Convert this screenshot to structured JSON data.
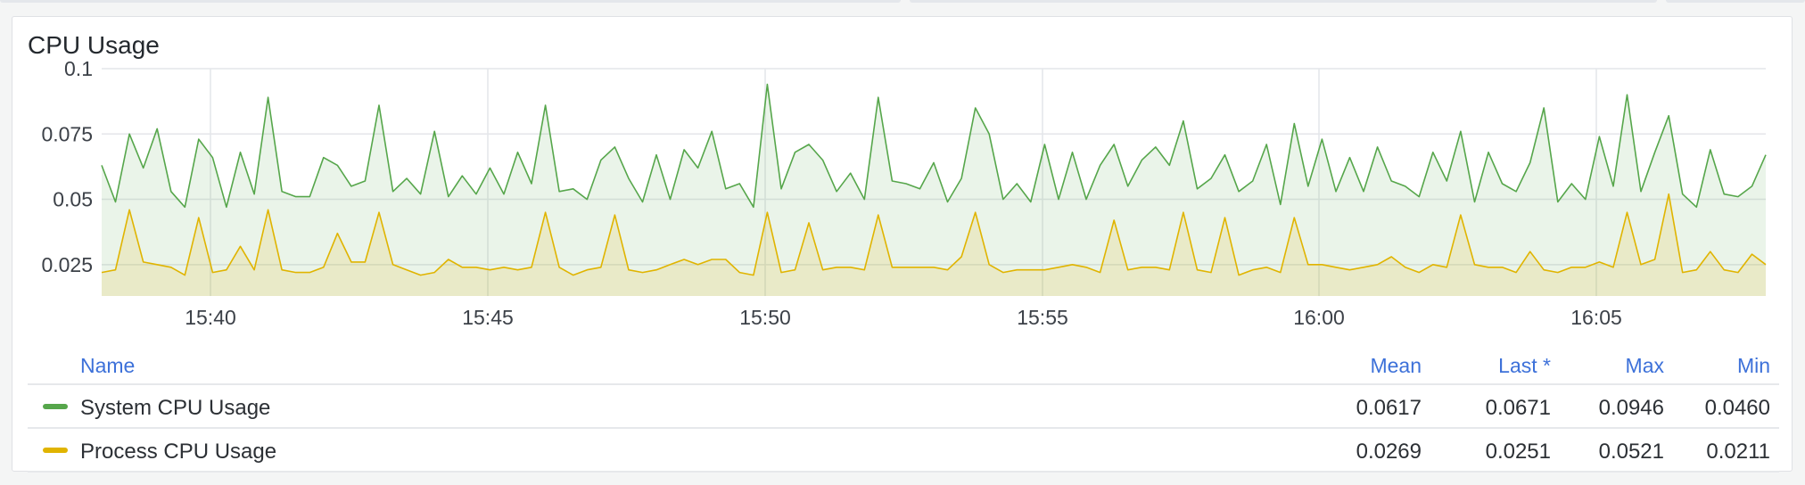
{
  "panel": {
    "title": "CPU Usage"
  },
  "legend": {
    "headers": {
      "name": "Name",
      "mean": "Mean",
      "last": "Last *",
      "max": "Max",
      "min": "Min"
    },
    "rows": [
      {
        "name": "System CPU Usage",
        "color": "#56a64b",
        "mean": "0.0617",
        "last": "0.0671",
        "max": "0.0946",
        "min": "0.0460"
      },
      {
        "name": "Process CPU Usage",
        "color": "#e0b400",
        "mean": "0.0269",
        "last": "0.0251",
        "max": "0.0521",
        "min": "0.0211"
      }
    ]
  },
  "chart_data": {
    "type": "area",
    "title": "CPU Usage",
    "xlabel": "",
    "ylabel": "",
    "x_ticks": [
      "15:40",
      "15:45",
      "15:50",
      "15:55",
      "16:00",
      "16:05"
    ],
    "y_ticks": [
      "0.025",
      "0.05",
      "0.075",
      "0.1"
    ],
    "ylim": [
      0.013,
      0.1
    ],
    "grid": true,
    "legend_placement": "bottom",
    "series": [
      {
        "name": "System CPU Usage",
        "color": "#56a64b",
        "values": [
          0.063,
          0.049,
          0.075,
          0.062,
          0.077,
          0.053,
          0.047,
          0.073,
          0.066,
          0.047,
          0.068,
          0.052,
          0.089,
          0.053,
          0.051,
          0.051,
          0.066,
          0.063,
          0.055,
          0.057,
          0.086,
          0.053,
          0.058,
          0.052,
          0.076,
          0.051,
          0.059,
          0.052,
          0.062,
          0.052,
          0.068,
          0.056,
          0.086,
          0.053,
          0.054,
          0.05,
          0.065,
          0.07,
          0.058,
          0.049,
          0.067,
          0.05,
          0.069,
          0.062,
          0.076,
          0.054,
          0.056,
          0.047,
          0.094,
          0.054,
          0.068,
          0.071,
          0.065,
          0.053,
          0.06,
          0.05,
          0.089,
          0.057,
          0.056,
          0.054,
          0.064,
          0.049,
          0.058,
          0.085,
          0.075,
          0.05,
          0.056,
          0.049,
          0.071,
          0.05,
          0.068,
          0.05,
          0.063,
          0.071,
          0.055,
          0.065,
          0.07,
          0.063,
          0.08,
          0.054,
          0.058,
          0.067,
          0.053,
          0.057,
          0.071,
          0.048,
          0.079,
          0.055,
          0.073,
          0.053,
          0.066,
          0.053,
          0.07,
          0.057,
          0.055,
          0.051,
          0.068,
          0.057,
          0.076,
          0.049,
          0.068,
          0.056,
          0.053,
          0.064,
          0.085,
          0.049,
          0.056,
          0.05,
          0.074,
          0.055,
          0.09,
          0.053,
          0.068,
          0.082,
          0.052,
          0.047,
          0.069,
          0.052,
          0.051,
          0.055,
          0.067
        ]
      },
      {
        "name": "Process CPU Usage",
        "color": "#e0b400",
        "values": [
          0.022,
          0.023,
          0.046,
          0.026,
          0.025,
          0.024,
          0.021,
          0.043,
          0.022,
          0.023,
          0.032,
          0.023,
          0.046,
          0.023,
          0.022,
          0.022,
          0.024,
          0.037,
          0.026,
          0.026,
          0.045,
          0.025,
          0.023,
          0.021,
          0.022,
          0.027,
          0.024,
          0.024,
          0.023,
          0.024,
          0.023,
          0.024,
          0.045,
          0.024,
          0.021,
          0.023,
          0.024,
          0.044,
          0.023,
          0.022,
          0.023,
          0.025,
          0.027,
          0.025,
          0.027,
          0.027,
          0.022,
          0.021,
          0.045,
          0.022,
          0.023,
          0.041,
          0.023,
          0.024,
          0.024,
          0.023,
          0.044,
          0.024,
          0.024,
          0.024,
          0.024,
          0.023,
          0.028,
          0.045,
          0.025,
          0.022,
          0.023,
          0.023,
          0.023,
          0.024,
          0.025,
          0.024,
          0.022,
          0.042,
          0.023,
          0.024,
          0.024,
          0.023,
          0.045,
          0.023,
          0.022,
          0.043,
          0.021,
          0.023,
          0.024,
          0.022,
          0.043,
          0.025,
          0.025,
          0.024,
          0.023,
          0.024,
          0.025,
          0.028,
          0.024,
          0.022,
          0.025,
          0.024,
          0.044,
          0.025,
          0.024,
          0.024,
          0.022,
          0.03,
          0.023,
          0.022,
          0.024,
          0.024,
          0.026,
          0.024,
          0.045,
          0.025,
          0.027,
          0.052,
          0.022,
          0.023,
          0.03,
          0.023,
          0.022,
          0.029,
          0.025
        ]
      }
    ]
  }
}
